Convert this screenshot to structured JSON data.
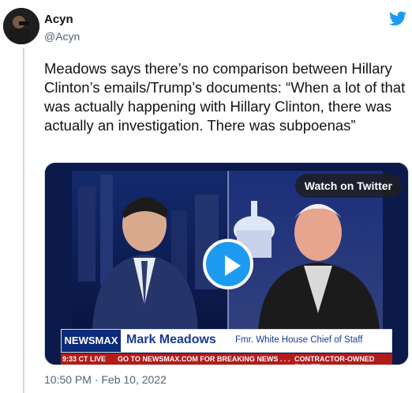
{
  "tweet": {
    "name": "Acyn",
    "handle": "@Acyn",
    "text": "Meadows says there’s no comparison between Hillary Clinton’s emails/Trump’s documents: “When a lot of that was actually happening with Hillary Clinton, there was actually an investigation. There was subpoenas”",
    "timestamp": "10:50 PM · Feb 10, 2022"
  },
  "media": {
    "watch_label": "Watch on Twitter",
    "lower_third": {
      "logo": "NEWSMAX",
      "name": "Mark Meadows",
      "role": "Fmr. White House Chief of Staff"
    },
    "ticker": {
      "time": "9:33 CT  LIVE",
      "message1": "GO TO NEWSMAX.COM FOR BREAKING NEWS . . .",
      "message2": "CONTRACTOR-OWNED FIGHTE"
    }
  },
  "colors": {
    "twitter_blue": "#1d9bf0",
    "newsmax_blue": "#0b2a7a",
    "ticker_red": "#b31b1b"
  }
}
